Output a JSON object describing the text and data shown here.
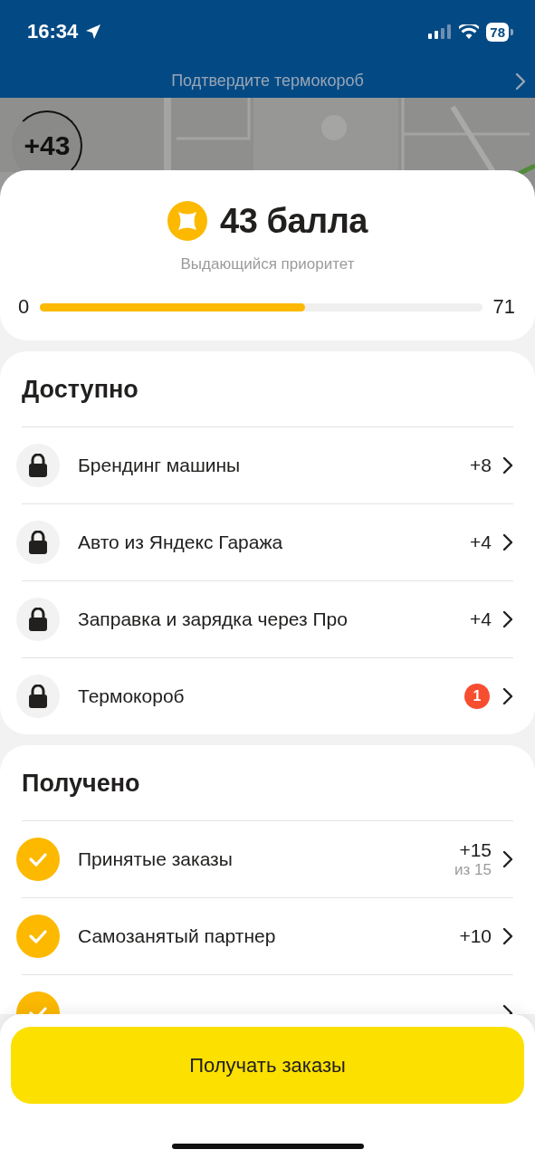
{
  "status_bar": {
    "time": "16:34",
    "battery": "78"
  },
  "banner": {
    "text": "Подтвердите термокороб"
  },
  "map": {
    "kind": "picture",
    "badge": "+43"
  },
  "score": {
    "title": "43 балла",
    "subtitle": "Выдающийся приоритет",
    "min": "0",
    "max": "71",
    "level": 0.6
  },
  "sections": [
    {
      "title": "Доступно",
      "items": [
        {
          "kind": "locked",
          "label": "Брендинг машины",
          "value": "+8"
        },
        {
          "kind": "locked",
          "label": "Авто из Яндекс Гаража",
          "value": "+4"
        },
        {
          "kind": "locked",
          "label": "Заправка и зарядка через Про",
          "value": "+4"
        },
        {
          "kind": "locked",
          "label": "Термокороб",
          "badge": "1"
        }
      ]
    },
    {
      "title": "Получено",
      "items": [
        {
          "kind": "done",
          "label": "Принятые заказы",
          "value": "+15",
          "note": "из 15"
        },
        {
          "kind": "done",
          "label": "Самозанятый партнер",
          "value": "+10"
        },
        {
          "kind": "done"
        }
      ]
    }
  ],
  "button": {
    "label": "Получать заказы"
  }
}
